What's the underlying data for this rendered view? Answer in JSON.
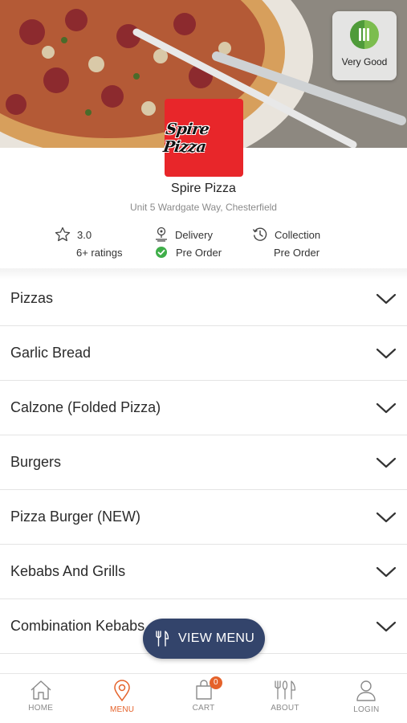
{
  "hygiene_rating": {
    "label": "Very Good",
    "color": "#7cbd4f"
  },
  "restaurant": {
    "logo_text": "Spire Pizza",
    "name": "Spire Pizza",
    "address": "Unit 5 Wardgate Way, Chesterfield",
    "logo_color": "#e8262a"
  },
  "info": {
    "rating_value": "3.0",
    "rating_count": "6+ ratings",
    "delivery_label": "Delivery",
    "delivery_status": "Pre Order",
    "collection_label": "Collection",
    "collection_status": "Pre Order"
  },
  "categories": [
    {
      "label": "Pizzas"
    },
    {
      "label": "Garlic Bread"
    },
    {
      "label": "Calzone (Folded Pizza)"
    },
    {
      "label": "Burgers"
    },
    {
      "label": "Pizza Burger (NEW)"
    },
    {
      "label": "Kebabs And Grills"
    },
    {
      "label": "Combination Kebabs"
    }
  ],
  "view_menu_button": {
    "label": "VIEW MENU",
    "color": "#33446b"
  },
  "tabbar": {
    "active_color": "#e5622a",
    "cart_count": "0",
    "tabs": [
      {
        "label": "HOME",
        "icon": "home-icon"
      },
      {
        "label": "MENU",
        "icon": "location-pin-icon"
      },
      {
        "label": "CART",
        "icon": "shopping-bag-icon"
      },
      {
        "label": "ABOUT",
        "icon": "cutlery-icon"
      },
      {
        "label": "LOGIN",
        "icon": "user-icon"
      }
    ]
  }
}
